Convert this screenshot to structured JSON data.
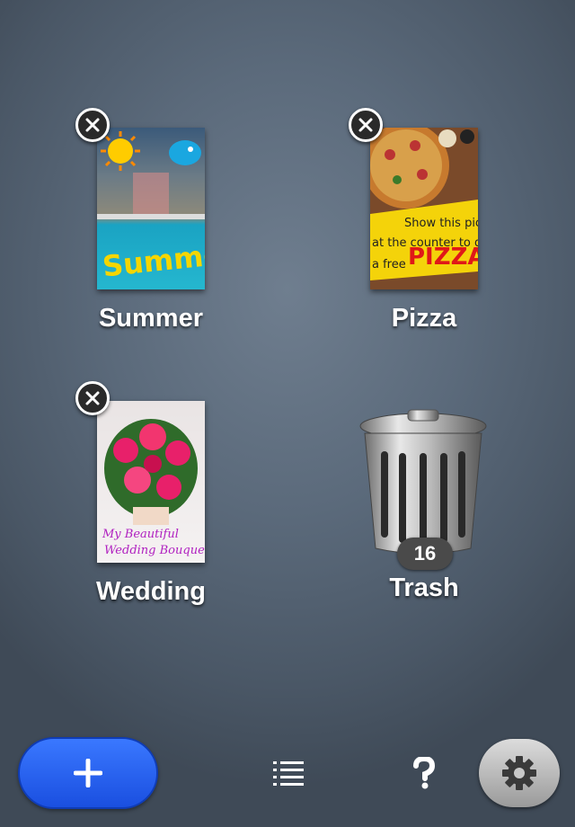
{
  "documents": [
    {
      "name": "Summer",
      "thumbnail_text": "Summer"
    },
    {
      "name": "Pizza",
      "thumbnail_text": [
        "Show this pic",
        "at the counter to get",
        "a free",
        "PIZZA"
      ]
    },
    {
      "name": "Wedding",
      "thumbnail_text": [
        "My Beautiful",
        "Wedding Bouquet"
      ]
    }
  ],
  "trash": {
    "label": "Trash",
    "count": "16"
  },
  "toolbar": {
    "add_icon": "plus-icon",
    "list_icon": "list-icon",
    "help_icon": "question-icon",
    "settings_icon": "gear-icon"
  },
  "colors": {
    "add_button": "#2a63f5",
    "accent_text": "#ffffff"
  }
}
